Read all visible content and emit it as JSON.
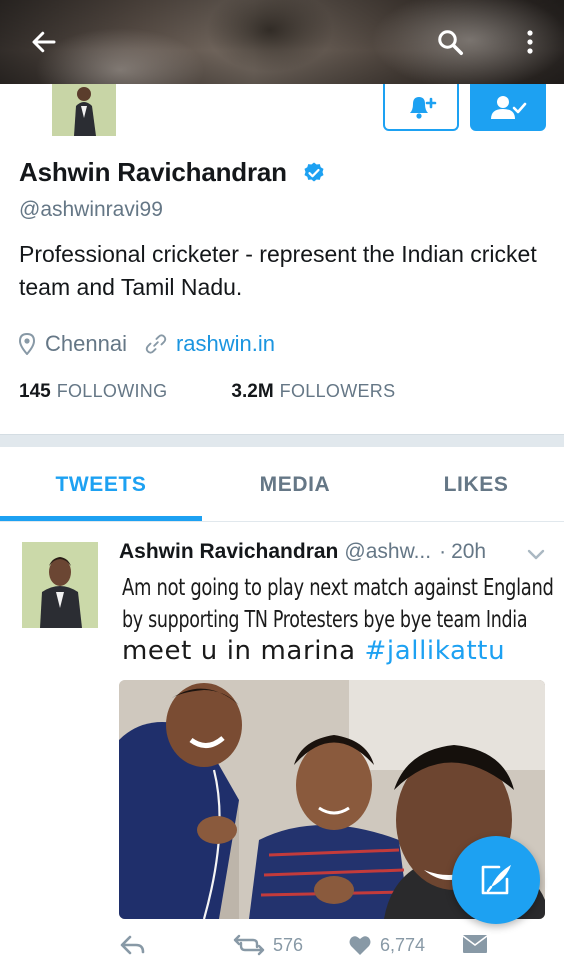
{
  "header": {
    "back_icon": "arrow-left-icon",
    "search_icon": "search-icon",
    "more_icon": "more-vertical-icon"
  },
  "profile": {
    "display_name": "Ashwin Ravichandran",
    "verified": true,
    "handle": "@ashwinravi99",
    "bio": "Professional cricketer - represent the Indian cricket team and Tamil Nadu.",
    "location": "Chennai",
    "website": "rashwin.in",
    "following_count": "145",
    "following_label": "FOLLOWING",
    "followers_count": "3.2M",
    "followers_label": "FOLLOWERS",
    "notify_icon": "bell-plus-icon",
    "following_button_icon": "person-check-icon"
  },
  "tabs": [
    {
      "label": "TWEETS",
      "active": true
    },
    {
      "label": "MEDIA",
      "active": false
    },
    {
      "label": "LIKES",
      "active": false
    }
  ],
  "tweet": {
    "author_name": "Ashwin Ravichandran",
    "author_handle": "@ashw...",
    "separator": "·",
    "time": "20h",
    "line1": "Am not going to play next match against England",
    "line2": "by supporting TN Protesters bye bye team India",
    "line3_text": "meet u in marina ",
    "hashtag": "#jallikattu",
    "retweets": "576",
    "likes": "6,774"
  },
  "colors": {
    "accent": "#1da1f2",
    "link": "#1b95e0",
    "muted": "#657786",
    "divider": "#e1e8ed"
  }
}
